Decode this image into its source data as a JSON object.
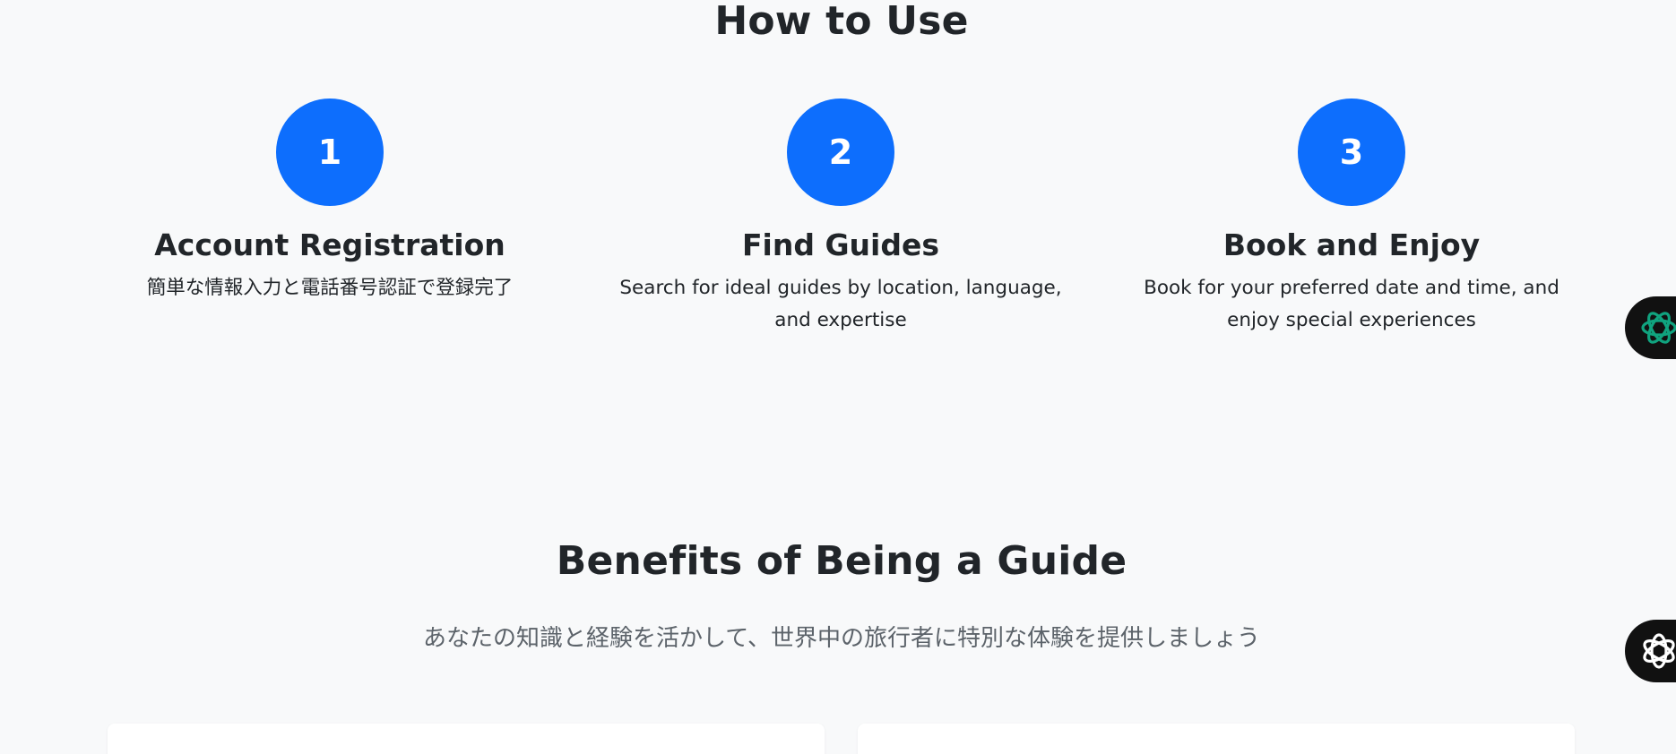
{
  "how_to_use": {
    "title": "How to Use",
    "steps": [
      {
        "number": "1",
        "title": "Account Registration",
        "description": "簡単な情報入力と電話番号認証で登録完了"
      },
      {
        "number": "2",
        "title": "Find Guides",
        "description": "Search for ideal guides by location, language, and expertise"
      },
      {
        "number": "3",
        "title": "Book and Enjoy",
        "description": "Book for your preferred date and time, and enjoy special experiences"
      }
    ]
  },
  "benefits": {
    "title": "Benefits of Being a Guide",
    "subtitle": "あなたの知識と経験を活かして、世界中の旅行者に特別な体験を提供しましょう"
  },
  "colors": {
    "accent": "#0d6efd",
    "background": "#f8f9fa",
    "widget_icon_green": "#10a37f"
  },
  "widgets": [
    {
      "icon": "openai-green-icon"
    },
    {
      "icon": "openai-white-icon"
    }
  ]
}
